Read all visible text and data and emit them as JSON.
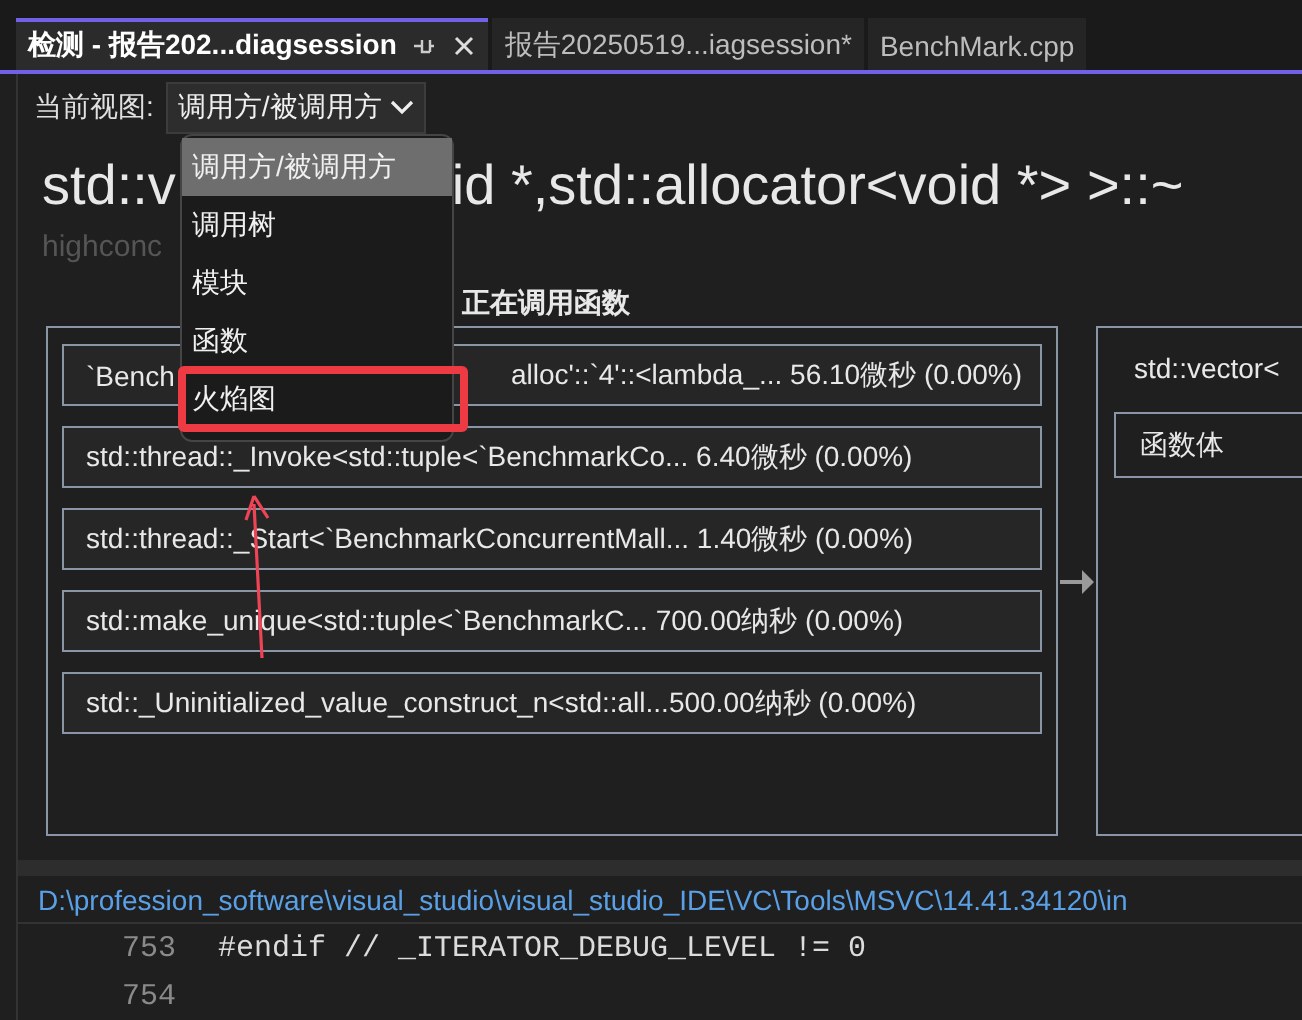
{
  "tabs": [
    {
      "label": "检测 - 报告202...diagsession",
      "selected": true,
      "pinnable": true,
      "closable": true
    },
    {
      "label": "报告20250519...iagsession*",
      "selected": false,
      "pinnable": false,
      "closable": false
    },
    {
      "label": "BenchMark.cpp",
      "selected": false,
      "pinnable": false,
      "closable": false
    }
  ],
  "view_selector": {
    "label": "当前视图:",
    "value": "调用方/被调用方"
  },
  "view_menu": {
    "items": [
      {
        "label": "调用方/被调用方",
        "selected": true
      },
      {
        "label": "调用树",
        "selected": false
      },
      {
        "label": "模块",
        "selected": false
      },
      {
        "label": "函数",
        "selected": false
      },
      {
        "label": "火焰图",
        "selected": false,
        "highlighted": true
      }
    ]
  },
  "heading": {
    "parts": [
      "std::v",
      "id *,std::allocator<void *> >::~"
    ]
  },
  "subtitle": "highconc",
  "calling_header": "正在调用函数",
  "calling_functions": [
    {
      "parts": [
        "`Bench",
        "alloc'::`4'::<lambda_... 56.10微秒 (0.00%)"
      ]
    },
    {
      "parts": [
        "std::thread::_Invoke<std::tuple<`BenchmarkCo... 6.40微秒 (0.00%)"
      ]
    },
    {
      "parts": [
        "std::thread::_Start<`BenchmarkConcurrentMall... 1.40微秒 (0.00%)"
      ]
    },
    {
      "parts": [
        "std::make_unique<std::tuple<`BenchmarkC...  700.00纳秒 (0.00%)"
      ]
    },
    {
      "parts": [
        "std::_Uninitialized_value_construct_n<std::all...500.00纳秒 (0.00%)"
      ]
    }
  ],
  "current_function": {
    "name": "std::vector<",
    "items": [
      "函数体"
    ]
  },
  "source_path": "D:\\profession_software\\visual_studio\\visual_studio_IDE\\VC\\Tools\\MSVC\\14.41.34120\\in",
  "code_lines": [
    {
      "number": "753",
      "text": "#endif // _ITERATOR_DEBUG_LEVEL != 0"
    },
    {
      "number": "754"
    }
  ]
}
